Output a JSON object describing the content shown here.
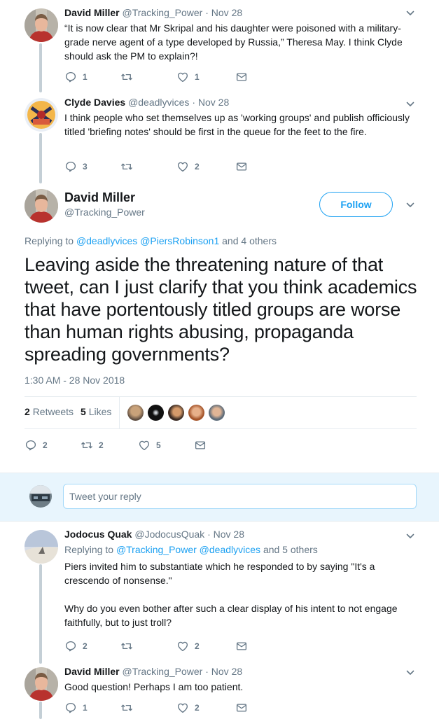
{
  "icons": {
    "reply": "reply-icon",
    "retweet": "retweet-icon",
    "like": "heart-icon",
    "message": "envelope-icon",
    "more": "chevron-down-icon"
  },
  "colors": {
    "accent": "#1da1f2",
    "muted": "#657786",
    "text": "#14171a",
    "reply_bg": "#e8f5fd"
  },
  "tweet1": {
    "name": "David Miller",
    "handle": "@Tracking_Power",
    "dot": "·",
    "date": "Nov 28",
    "text": "“It is now clear that Mr Skripal and his daughter were poisoned with a military-grade nerve agent of a type developed by Russia,” Theresa May.  I think Clyde should ask the PM to explain?!",
    "reply_count": "1",
    "retweet_count": "",
    "like_count": "1"
  },
  "tweet2": {
    "name": "Clyde Davies",
    "handle": "@deadlyvices",
    "dot": "·",
    "date": "Nov 28",
    "text": "I think people who set themselves up as 'working groups' and publish officiously titled 'briefing notes' should be first in the queue for the feet to the fire.",
    "reply_count": "3",
    "retweet_count": "",
    "like_count": "2"
  },
  "main": {
    "name": "David Miller",
    "handle": "@Tracking_Power",
    "follow_label": "Follow",
    "replying_prefix": "Replying to",
    "replying_user1": "@deadlyvices",
    "replying_user2": "@PiersRobinson1",
    "replying_suffix": "and 4 others",
    "text": "Leaving aside the threatening nature of that tweet, can I just clarify that you think academics that have portentously titled groups are worse than human rights abusing, propaganda spreading governments?",
    "timestamp": "1:30 AM - 28 Nov 2018",
    "retweets_count": "2",
    "retweets_label": "Retweets",
    "likes_count": "5",
    "likes_label": "Likes",
    "reply_count": "2",
    "retweet_count": "2",
    "like_count": "5"
  },
  "reply_box": {
    "placeholder": "Tweet your reply"
  },
  "tweet3": {
    "name": "Jodocus Quak",
    "handle": "@JodocusQuak",
    "dot": "·",
    "date": "Nov 28",
    "replying_prefix": "Replying to",
    "replying_user1": "@Tracking_Power",
    "replying_user2": "@deadlyvices",
    "replying_suffix": "and 5 others",
    "text": "Piers invited him to substantiate which he responded to by saying \"It's a crescendo of nonsense.\"\n\nWhy do you even bother after such a clear display of his intent to not engage faithfully, but to just troll?",
    "reply_count": "2",
    "retweet_count": "",
    "like_count": "2"
  },
  "tweet4": {
    "name": "David Miller",
    "handle": "@Tracking_Power",
    "dot": "·",
    "date": "Nov 28",
    "text": "Good question!  Perhaps I am too patient.",
    "reply_count": "1",
    "retweet_count": "",
    "like_count": "2"
  }
}
